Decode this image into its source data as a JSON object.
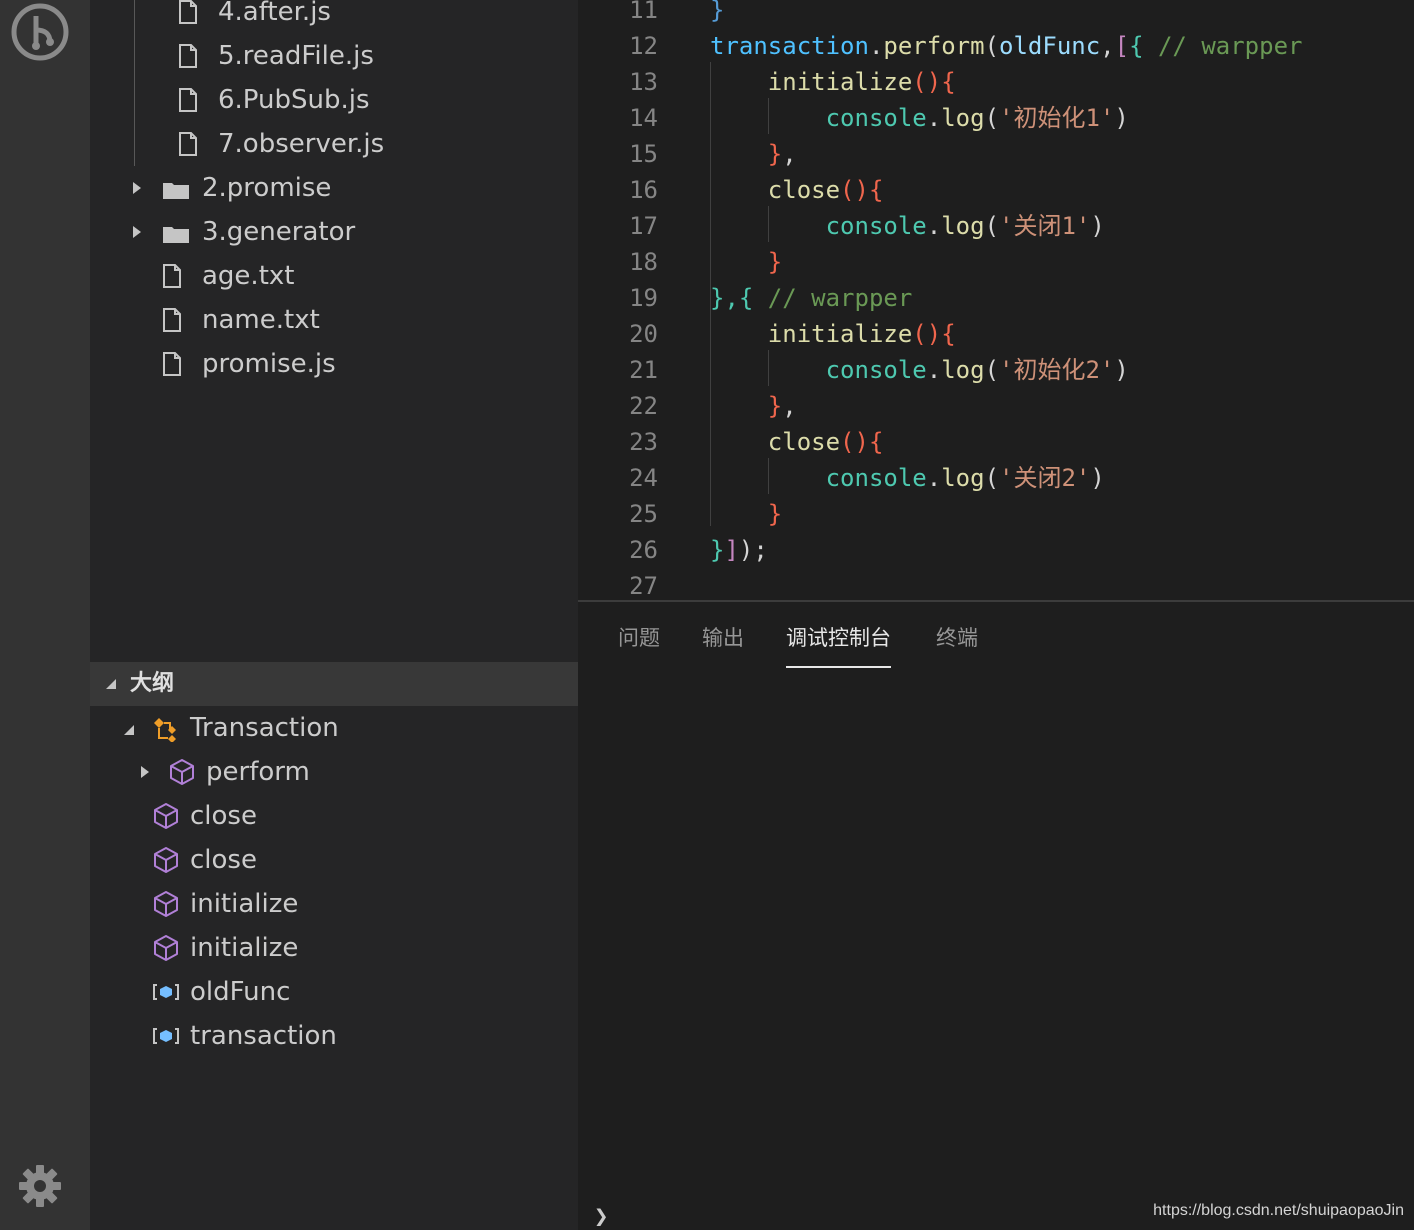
{
  "explorer": {
    "files_nested": [
      "4.after.js",
      "5.readFile.js",
      "6.PubSub.js",
      "7.observer.js"
    ],
    "folders": [
      "2.promise",
      "3.generator"
    ],
    "files": [
      "age.txt",
      "name.txt",
      "promise.js"
    ]
  },
  "outline": {
    "title": "大纲",
    "root": "Transaction",
    "child": "perform",
    "items": [
      "close",
      "close",
      "initialize",
      "initialize",
      "oldFunc",
      "transaction"
    ]
  },
  "editor": {
    "lines": [
      {
        "n": "11",
        "tokens": [
          {
            "t": "}",
            "c": "#569cd6"
          }
        ]
      },
      {
        "n": "12",
        "tokens": [
          {
            "t": "transaction",
            "c": "#4fc1ff"
          },
          {
            "t": ".",
            "c": "#d4d4d4"
          },
          {
            "t": "perform",
            "c": "#dcdcaa"
          },
          {
            "t": "(",
            "c": "#d4d4d4"
          },
          {
            "t": "oldFunc",
            "c": "#9cdcfe"
          },
          {
            "t": ",",
            "c": "#d4d4d4"
          },
          {
            "t": "[",
            "c": "#c586c0"
          },
          {
            "t": "{",
            "c": "#4ec9b0"
          },
          {
            "t": " // warpper",
            "c": "#6a9955"
          }
        ]
      },
      {
        "n": "13",
        "tokens": [
          {
            "t": "    ",
            "c": "#d4d4d4"
          },
          {
            "t": "initialize",
            "c": "#dcdcaa"
          },
          {
            "t": "(){",
            "c": "#f0664d"
          }
        ]
      },
      {
        "n": "14",
        "tokens": [
          {
            "t": "        ",
            "c": "#d4d4d4"
          },
          {
            "t": "console",
            "c": "#4ec9b0"
          },
          {
            "t": ".",
            "c": "#d4d4d4"
          },
          {
            "t": "log",
            "c": "#dcdcaa"
          },
          {
            "t": "(",
            "c": "#d4d4d4"
          },
          {
            "t": "'初始化1'",
            "c": "#ce9178"
          },
          {
            "t": ")",
            "c": "#d4d4d4"
          }
        ]
      },
      {
        "n": "15",
        "tokens": [
          {
            "t": "    ",
            "c": "#d4d4d4"
          },
          {
            "t": "}",
            "c": "#f0664d"
          },
          {
            "t": ",",
            "c": "#d4d4d4"
          }
        ]
      },
      {
        "n": "16",
        "tokens": [
          {
            "t": "    ",
            "c": "#d4d4d4"
          },
          {
            "t": "close",
            "c": "#dcdcaa"
          },
          {
            "t": "(){",
            "c": "#f0664d"
          }
        ]
      },
      {
        "n": "17",
        "tokens": [
          {
            "t": "        ",
            "c": "#d4d4d4"
          },
          {
            "t": "console",
            "c": "#4ec9b0"
          },
          {
            "t": ".",
            "c": "#d4d4d4"
          },
          {
            "t": "log",
            "c": "#dcdcaa"
          },
          {
            "t": "(",
            "c": "#d4d4d4"
          },
          {
            "t": "'关闭1'",
            "c": "#ce9178"
          },
          {
            "t": ")",
            "c": "#d4d4d4"
          }
        ]
      },
      {
        "n": "18",
        "tokens": [
          {
            "t": "    ",
            "c": "#d4d4d4"
          },
          {
            "t": "}",
            "c": "#f0664d"
          }
        ]
      },
      {
        "n": "19",
        "tokens": [
          {
            "t": "},{",
            "c": "#4ec9b0"
          },
          {
            "t": " // warpper",
            "c": "#6a9955"
          }
        ]
      },
      {
        "n": "20",
        "tokens": [
          {
            "t": "    ",
            "c": "#d4d4d4"
          },
          {
            "t": "initialize",
            "c": "#dcdcaa"
          },
          {
            "t": "(){",
            "c": "#f0664d"
          }
        ]
      },
      {
        "n": "21",
        "tokens": [
          {
            "t": "        ",
            "c": "#d4d4d4"
          },
          {
            "t": "console",
            "c": "#4ec9b0"
          },
          {
            "t": ".",
            "c": "#d4d4d4"
          },
          {
            "t": "log",
            "c": "#dcdcaa"
          },
          {
            "t": "(",
            "c": "#d4d4d4"
          },
          {
            "t": "'初始化2'",
            "c": "#ce9178"
          },
          {
            "t": ")",
            "c": "#d4d4d4"
          }
        ]
      },
      {
        "n": "22",
        "tokens": [
          {
            "t": "    ",
            "c": "#d4d4d4"
          },
          {
            "t": "}",
            "c": "#f0664d"
          },
          {
            "t": ",",
            "c": "#d4d4d4"
          }
        ]
      },
      {
        "n": "23",
        "tokens": [
          {
            "t": "    ",
            "c": "#d4d4d4"
          },
          {
            "t": "close",
            "c": "#dcdcaa"
          },
          {
            "t": "(){",
            "c": "#f0664d"
          }
        ]
      },
      {
        "n": "24",
        "tokens": [
          {
            "t": "        ",
            "c": "#d4d4d4"
          },
          {
            "t": "console",
            "c": "#4ec9b0"
          },
          {
            "t": ".",
            "c": "#d4d4d4"
          },
          {
            "t": "log",
            "c": "#dcdcaa"
          },
          {
            "t": "(",
            "c": "#d4d4d4"
          },
          {
            "t": "'关闭2'",
            "c": "#ce9178"
          },
          {
            "t": ")",
            "c": "#d4d4d4"
          }
        ]
      },
      {
        "n": "25",
        "tokens": [
          {
            "t": "    ",
            "c": "#d4d4d4"
          },
          {
            "t": "}",
            "c": "#f0664d"
          }
        ]
      },
      {
        "n": "26",
        "tokens": [
          {
            "t": "}",
            "c": "#4ec9b0"
          },
          {
            "t": "]",
            "c": "#c586c0"
          },
          {
            "t": ");",
            "c": "#d4d4d4"
          }
        ]
      },
      {
        "n": "27",
        "tokens": []
      }
    ]
  },
  "panel": {
    "tabs": [
      "问题",
      "输出",
      "调试控制台",
      "终端"
    ],
    "active_tab": "调试控制台",
    "prompt": "❯"
  },
  "watermark": "https://blog.csdn.net/shuipaopaoJin",
  "icons": {
    "activity_top": "git-lens-icon",
    "activity_bottom": "settings-gear-icon",
    "file": "file-icon",
    "folder": "folder-icon",
    "class": "class-icon",
    "method": "method-cube-icon",
    "variable": "variable-icon"
  },
  "colors": {
    "sidebar_bg": "#252526",
    "editor_bg": "#1e1e1e",
    "activity_bg": "#333333",
    "method_purple": "#b180d7",
    "class_orange": "#ee9d28",
    "variable_blue": "#75beff"
  }
}
